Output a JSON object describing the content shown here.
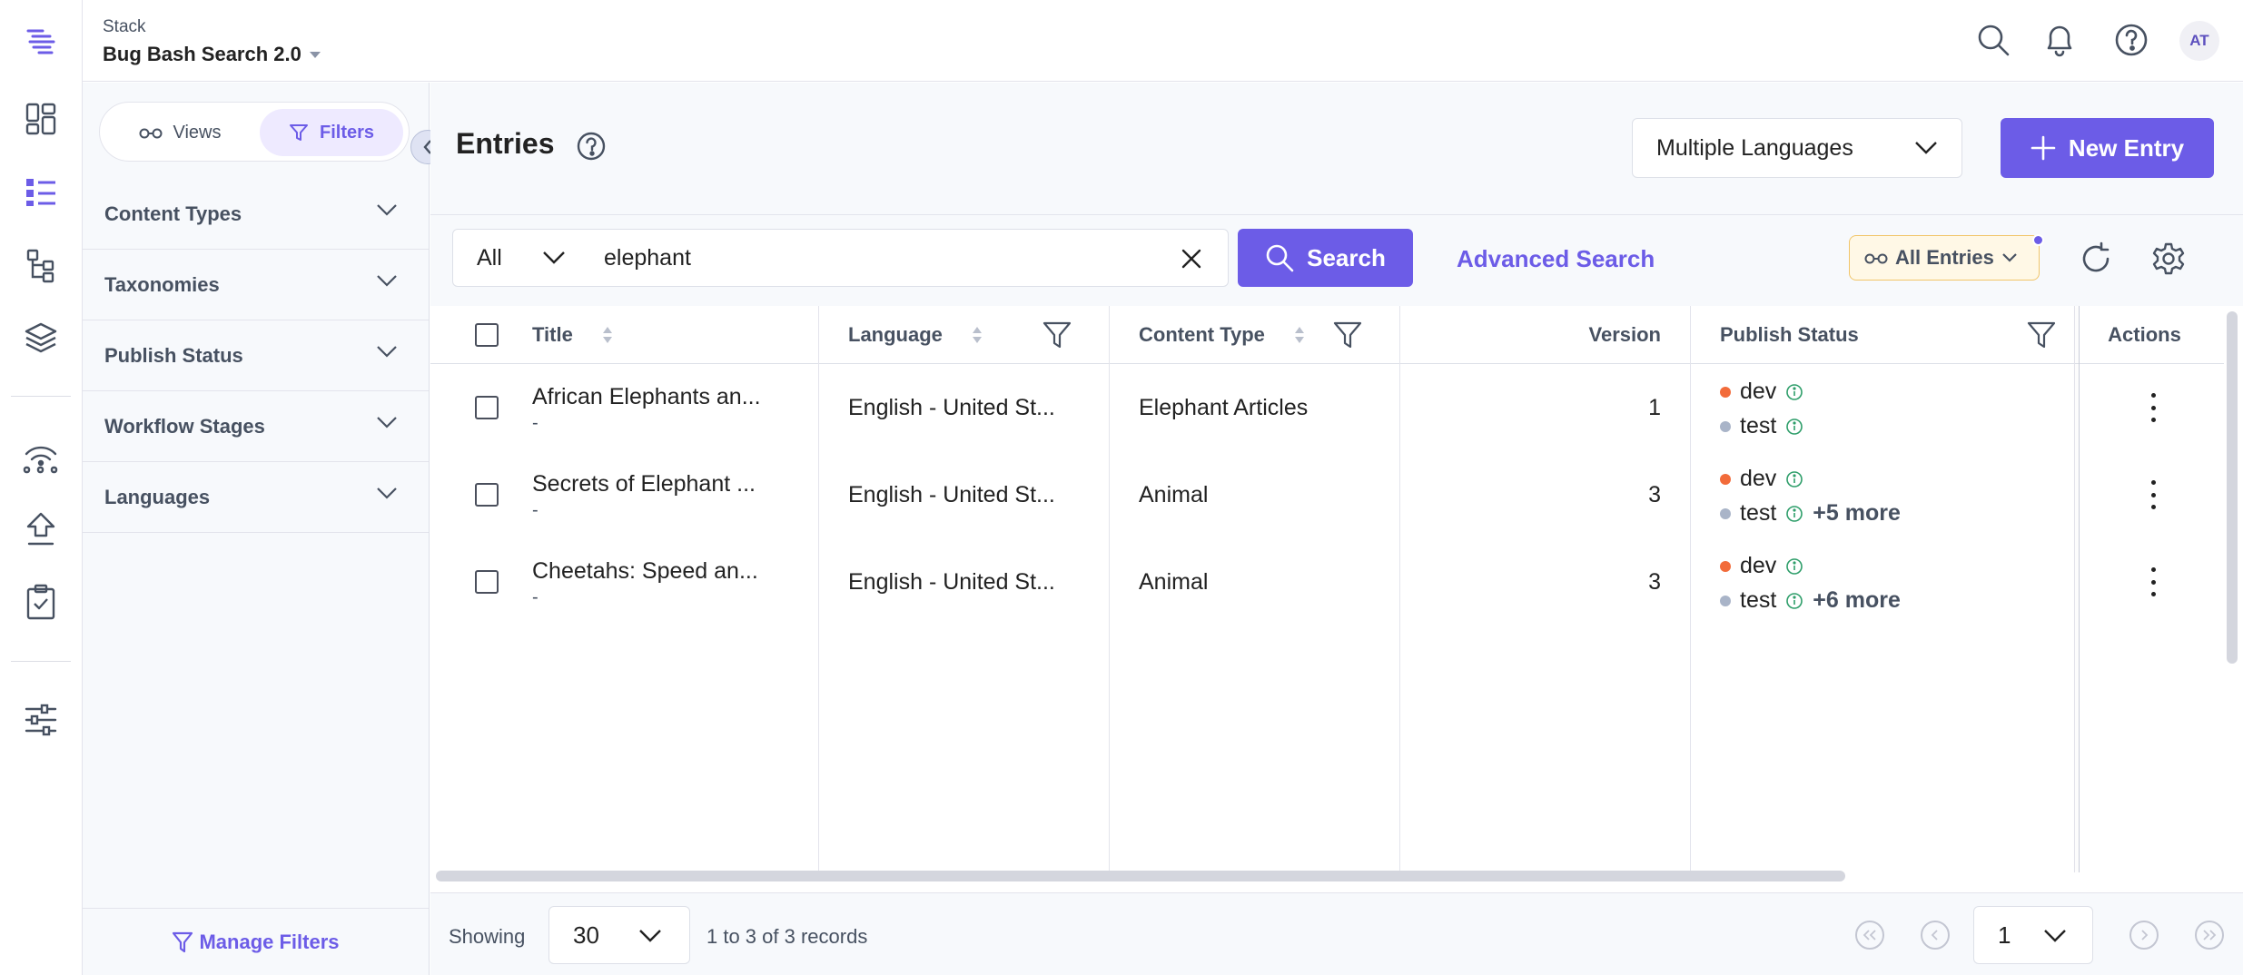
{
  "header": {
    "stack_label": "Stack",
    "stack_name": "Bug Bash Search 2.0",
    "avatar_initials": "AT"
  },
  "rail": {
    "icons": [
      "logo-icon",
      "dashboard-icon",
      "entries-icon",
      "content-models-icon",
      "assets-icon",
      "releases-icon",
      "deploy-icon",
      "tasks-icon",
      "settings-sliders-icon"
    ]
  },
  "filter_panel": {
    "views_label": "Views",
    "filters_label": "Filters",
    "sections": [
      "Content Types",
      "Taxonomies",
      "Publish Status",
      "Workflow Stages",
      "Languages"
    ],
    "manage_filters_label": "Manage Filters"
  },
  "main": {
    "title": "Entries",
    "language_select": "Multiple Languages",
    "new_entry_label": "New Entry"
  },
  "search": {
    "scope": "All",
    "query": "elephant",
    "button_label": "Search",
    "advanced_label": "Advanced Search",
    "view_label": "All Entries"
  },
  "table": {
    "columns": {
      "title": "Title",
      "language": "Language",
      "content_type": "Content Type",
      "version": "Version",
      "publish_status": "Publish Status",
      "actions": "Actions"
    },
    "rows": [
      {
        "title": "African Elephants an...",
        "subtitle": "-",
        "language": "English - United St...",
        "content_type": "Elephant Articles",
        "version": "1",
        "status_1": "dev",
        "status_2": "test",
        "more": ""
      },
      {
        "title": "Secrets of Elephant ...",
        "subtitle": "-",
        "language": "English - United St...",
        "content_type": "Animal",
        "version": "3",
        "status_1": "dev",
        "status_2": "test",
        "more": "+5 more"
      },
      {
        "title": "Cheetahs: Speed an...",
        "subtitle": "-",
        "language": "English - United St...",
        "content_type": "Animal",
        "version": "3",
        "status_1": "dev",
        "status_2": "test",
        "more": "+6 more"
      }
    ]
  },
  "footer": {
    "showing_label": "Showing",
    "page_size": "30",
    "records_text": "1 to 3 of 3 records",
    "current_page": "1"
  },
  "colors": {
    "accent": "#6c5ce7",
    "status_dev": "#f26b3a",
    "status_test": "#a9b4c8",
    "info_green": "#2e9e6a"
  }
}
